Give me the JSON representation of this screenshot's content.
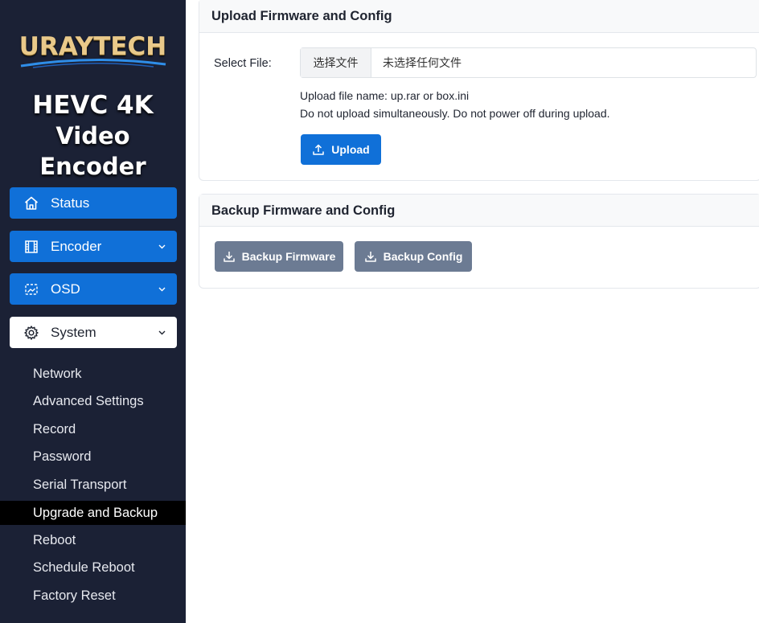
{
  "brand": {
    "logo": "URAYTECH",
    "product_line1": "HEVC 4K",
    "product_line2": "Video Encoder"
  },
  "nav": {
    "status": "Status",
    "encoder": "Encoder",
    "osd": "OSD",
    "system": "System",
    "system_items": [
      "Network",
      "Advanced Settings",
      "Record",
      "Password",
      "Serial Transport",
      "Upgrade and Backup",
      "Reboot",
      "Schedule Reboot",
      "Factory Reset"
    ],
    "active_item": "Upgrade and Backup"
  },
  "upload_section": {
    "title": "Upload Firmware and Config",
    "select_label": "Select File:",
    "file_button": "选择文件",
    "file_status": "未选择任何文件",
    "hint1": "Upload file name: up.rar or box.ini",
    "hint2": "Do not upload simultaneously. Do not power off during upload.",
    "upload_button": "Upload"
  },
  "backup_section": {
    "title": "Backup Firmware and Config",
    "backup_firmware_button": "Backup Firmware",
    "backup_config_button": "Backup Config"
  },
  "colors": {
    "sidebar_bg": "#1b2135",
    "primary": "#1070d8",
    "secondary": "#6c7b93",
    "active_item_bg": "#000000"
  }
}
